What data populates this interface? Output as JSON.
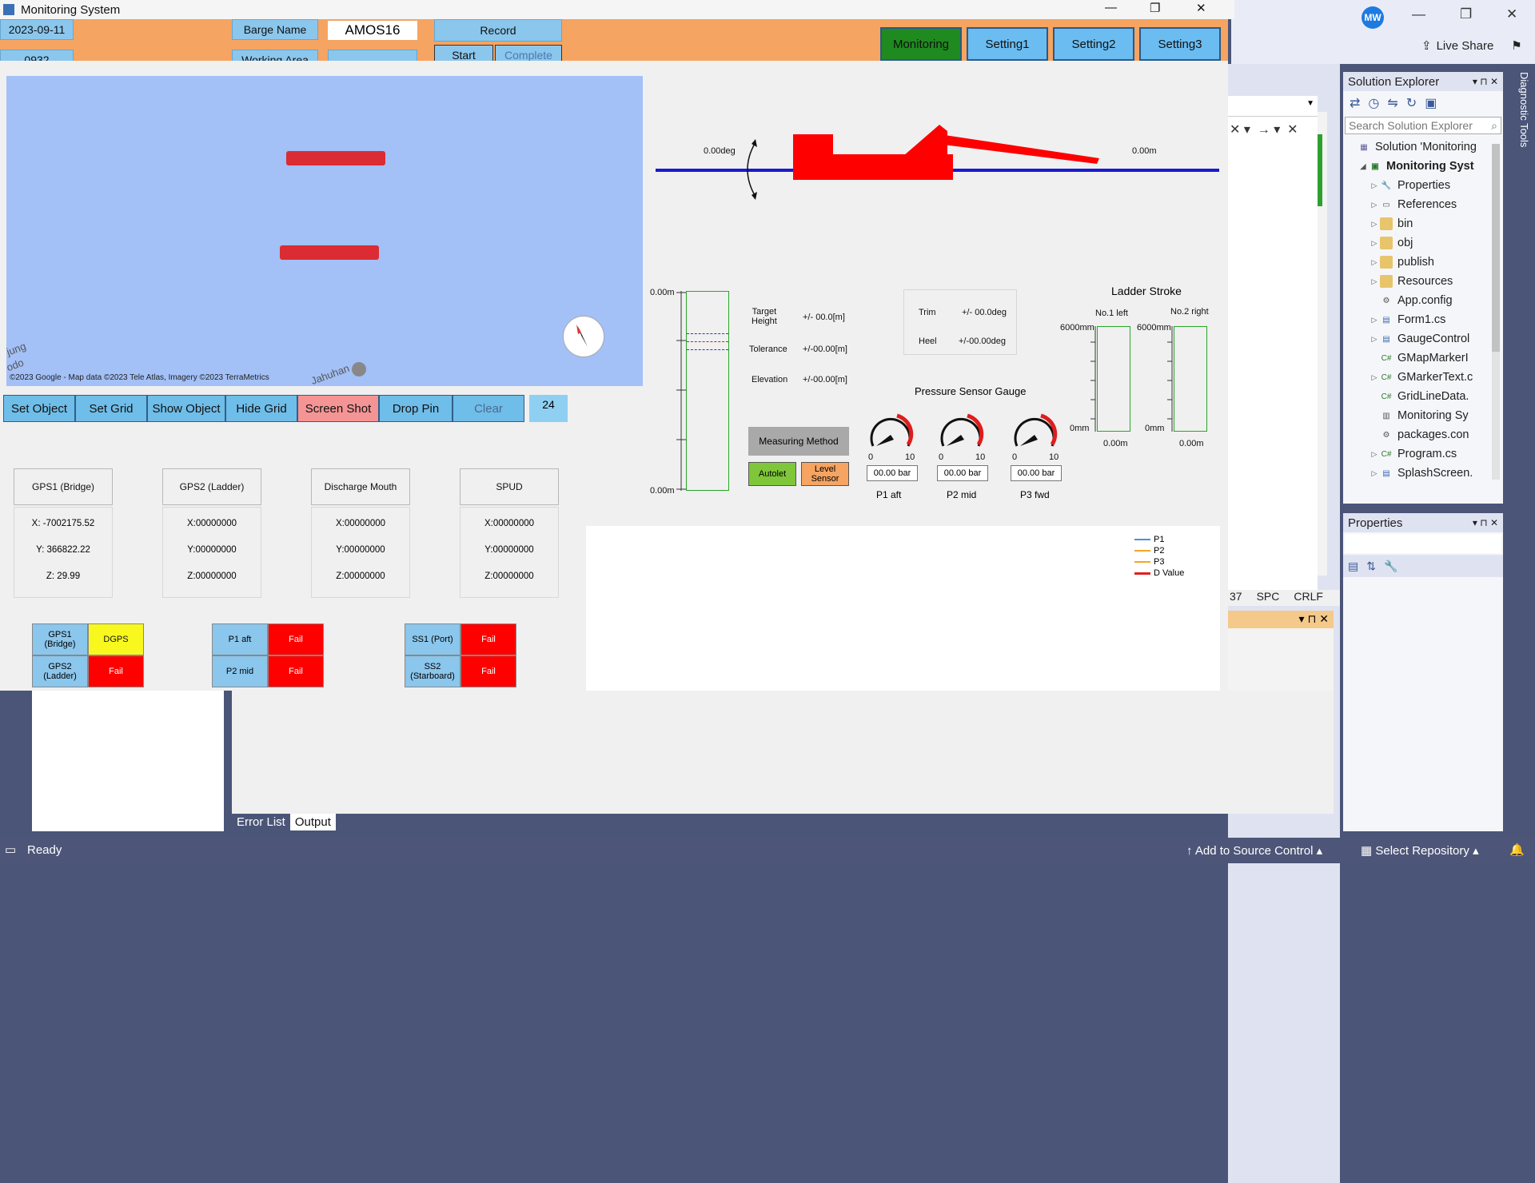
{
  "window": {
    "title": "Monitoring System",
    "minimize": "—",
    "restore": "❐",
    "close": "✕"
  },
  "header": {
    "date": "2023-09-11",
    "time": "0932",
    "barge_name_label": "Barge Name",
    "barge_name_value": "AMOS16",
    "working_area_label": "Working Area",
    "record_label": "Record",
    "start_label": "Start",
    "complete_label": "Complete"
  },
  "tabs": [
    {
      "label": "Monitoring"
    },
    {
      "label": "Setting1"
    },
    {
      "label": "Setting2"
    },
    {
      "label": "Setting3"
    }
  ],
  "map": {
    "attribution": "©2023 Google - Map data ©2023 Tele Atlas, Imagery ©2023 TerraMetrics",
    "place_left_1": "jung",
    "place_left_2": "odo",
    "place_bottom": "Jahuhan",
    "place_bottom_2": "an"
  },
  "map_buttons": [
    {
      "label": "Set Object"
    },
    {
      "label": "Set Grid"
    },
    {
      "label": "Show Object"
    },
    {
      "label": "Hide Grid"
    },
    {
      "label": "Screen Shot"
    },
    {
      "label": "Drop Pin"
    },
    {
      "label": "Clear"
    }
  ],
  "map_counter": "24",
  "gps_boxes": [
    {
      "title": "GPS1 (Bridge)",
      "x": "X: -7002175.52",
      "y": "Y: 366822.22",
      "z": "Z: 29.99"
    },
    {
      "title": "GPS2 (Ladder)",
      "x": "X:00000000",
      "y": "Y:00000000",
      "z": "Z:00000000"
    },
    {
      "title": "Discharge Mouth",
      "x": "X:00000000",
      "y": "Y:00000000",
      "z": "Z:00000000"
    },
    {
      "title": "SPUD",
      "x": "X:00000000",
      "y": "Y:00000000",
      "z": "Z:00000000"
    }
  ],
  "status_grid": [
    {
      "name_1": "GPS1\n(Bridge)",
      "value_1": "DGPS",
      "name_2": "GPS2\n(Ladder)",
      "value_2": "Fail"
    },
    {
      "name_1": "P1 aft",
      "value_1": "Fail",
      "name_2": "P2 mid",
      "value_2": "Fail"
    },
    {
      "name_1": "SS1 (Port)",
      "value_1": "Fail",
      "name_2": "SS2\n(Starboard)",
      "value_2": "Fail"
    }
  ],
  "barge_view": {
    "angle_label": "0.00deg",
    "distance_label": "0.00m"
  },
  "depth": {
    "top_label": "0.00m",
    "bottom_label": "0.00m"
  },
  "targets": {
    "height_label": "Target\nHeight",
    "height_value": "+/- 00.0[m]",
    "tolerance_label": "Tolerance",
    "tolerance_value": "+/-00.00[m]",
    "elevation_label": "Elevation",
    "elevation_value": "+/-00.00[m]"
  },
  "trim_heel": {
    "trim_label": "Trim",
    "trim_value": "+/- 00.0deg",
    "heel_label": "Heel",
    "heel_value": "+/-00.00deg"
  },
  "measuring": {
    "method_label": "Measuring Method",
    "autolet": "Autolet",
    "level_sensor": "Level\nSensor"
  },
  "pressure": {
    "title": "Pressure Sensor Gauge",
    "gauges": [
      {
        "name": "P1 aft",
        "min": "0",
        "max": "10",
        "value": "00.00 bar"
      },
      {
        "name": "P2 mid",
        "min": "0",
        "max": "10",
        "value": "00.00 bar"
      },
      {
        "name": "P3 fwd",
        "min": "0",
        "max": "10",
        "value": "00.00 bar"
      }
    ]
  },
  "ladder": {
    "title": "Ladder Stroke",
    "left_label": "No.1 left",
    "right_label": "No.2 right",
    "max_left": "6000mm",
    "max_right": "6000mm",
    "min_left": "0mm",
    "min_right": "0mm",
    "val_left": "0.00m",
    "val_right": "0.00m"
  },
  "legend": [
    {
      "name": "P1",
      "color": "#4a90d9"
    },
    {
      "name": "P2",
      "color": "#f5a623"
    },
    {
      "name": "P3",
      "color": "#f5a623"
    },
    {
      "name": "D Value",
      "color": "#e02020"
    }
  ],
  "vs": {
    "live_share": "Live Share",
    "avatar": "MW",
    "diagnostic": "Diagnostic Tools",
    "solution_explorer": "Solution Explorer",
    "search_placeholder": "Search Solution Explorer",
    "tree": [
      {
        "label": "Solution 'Monitoring",
        "icon": "solution-icon",
        "indent": 0
      },
      {
        "label": "Monitoring Syst",
        "icon": "project-icon",
        "indent": 1,
        "bold": true
      },
      {
        "label": "Properties",
        "icon": "wrench-icon",
        "indent": 2
      },
      {
        "label": "References",
        "icon": "references-icon",
        "indent": 2
      },
      {
        "label": "bin",
        "icon": "folder-icon",
        "indent": 2
      },
      {
        "label": "obj",
        "icon": "folder-icon",
        "indent": 2
      },
      {
        "label": "publish",
        "icon": "folder-icon",
        "indent": 2
      },
      {
        "label": "Resources",
        "icon": "folder-icon",
        "indent": 2
      },
      {
        "label": "App.config",
        "icon": "config-icon",
        "indent": 2
      },
      {
        "label": "Form1.cs",
        "icon": "form-icon",
        "indent": 2
      },
      {
        "label": "GaugeControl",
        "icon": "form-icon",
        "indent": 2
      },
      {
        "label": "GMapMarkerI",
        "icon": "csharp-icon",
        "indent": 2
      },
      {
        "label": "GMarkerText.c",
        "icon": "csharp-icon",
        "indent": 2
      },
      {
        "label": "GridLineData.",
        "icon": "csharp-icon",
        "indent": 2
      },
      {
        "label": "Monitoring Sy",
        "icon": "file-icon",
        "indent": 2
      },
      {
        "label": "packages.con",
        "icon": "config-icon",
        "indent": 2
      },
      {
        "label": "Program.cs",
        "icon": "csharp-icon",
        "indent": 2
      },
      {
        "label": "SplashScreen.",
        "icon": "form-icon",
        "indent": 2
      }
    ],
    "properties": "Properties",
    "editor_status": {
      "col": "37",
      "spc": "SPC",
      "crlf": "CRLF"
    },
    "bottom_tabs": [
      {
        "label": "Error List"
      },
      {
        "label": "Output"
      }
    ],
    "status_ready": "Ready",
    "add_source": "Add to Source Control",
    "select_repo": "Select Repository"
  }
}
